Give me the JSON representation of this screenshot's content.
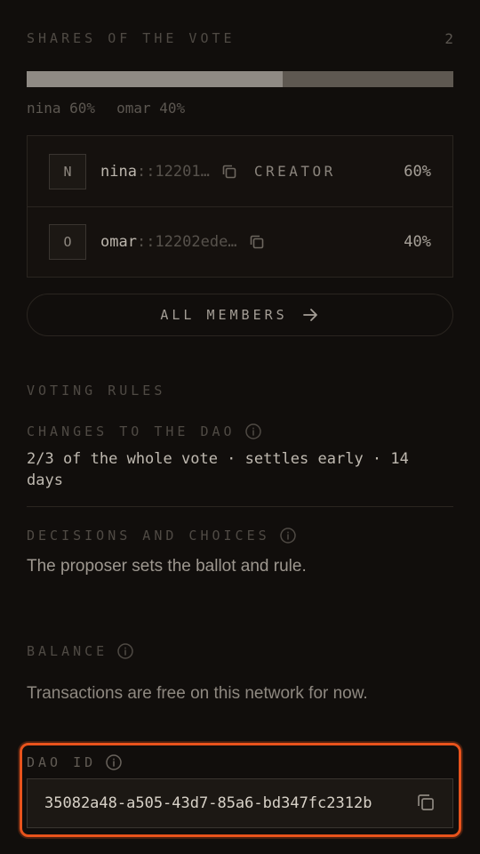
{
  "shares": {
    "title": "SHARES OF THE VOTE",
    "count": "2",
    "segments": [
      {
        "name": "nina",
        "fraction": 0.6
      },
      {
        "name": "omar",
        "fraction": 0.4
      }
    ],
    "legend": [
      "nina 60%",
      "omar 40%"
    ]
  },
  "members": [
    {
      "initial": "N",
      "name": "nina",
      "address": "::12201…",
      "badge": "CREATOR",
      "percent": "60%"
    },
    {
      "initial": "O",
      "name": "omar",
      "address": "::12202ede…",
      "badge": "",
      "percent": "40%"
    }
  ],
  "all_members_label": "ALL MEMBERS",
  "voting_rules": {
    "title": "VOTING RULES",
    "changes_label": "CHANGES TO THE DAO",
    "changes_value": "2/3 of the whole vote · settles early · 14 days",
    "decisions_label": "DECISIONS AND CHOICES",
    "decisions_value": "The proposer sets the ballot and rule."
  },
  "balance": {
    "label": "BALANCE",
    "value": "Transactions are free on this network for now."
  },
  "dao_id": {
    "label": "DAO ID",
    "value": "35082a48-a505-43d7-85a6-bd347fc2312b"
  },
  "colors": {
    "accent": "#e8531c",
    "background": "#110e0c"
  }
}
